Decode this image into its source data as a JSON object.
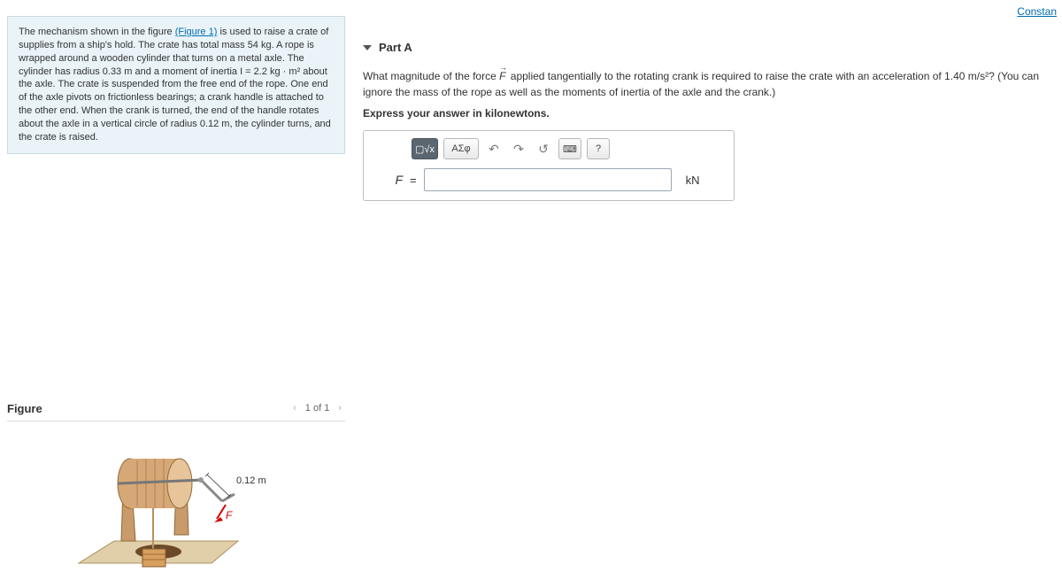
{
  "header": {
    "constants_link": "Constan"
  },
  "problem": {
    "text_before_fig": "The mechanism shown in the figure ",
    "figure_link": "(Figure 1)",
    "text_after_fig": " is used to raise a crate of supplies from a ship's hold. The crate has total mass 54 kg. A rope is wrapped around a wooden cylinder that turns on a metal axle. The cylinder has radius 0.33 m and a moment of inertia I = 2.2 kg · m² about the axle. The crate is suspended from the free end of the rope. One end of the axle pivots on frictionless bearings; a crank handle is attached to the other end. When the crank is turned, the end of the handle rotates about the axle in a vertical circle of radius 0.12 m, the cylinder turns, and the crate is raised."
  },
  "figure": {
    "title": "Figure",
    "nav_label": "1 of 1",
    "crank_radius_label": "0.12 m",
    "force_label": "F"
  },
  "part": {
    "title": "Part A",
    "q_before": "What magnitude of the force ",
    "q_after": " applied tangentially to the rotating crank is required to raise the crate with an acceleration of 1.40 m/s²? (You can ignore the mass of the rope as well as the moments of inertia of the axle and the crank.)",
    "instruction": "Express your answer in kilonewtons.",
    "variable": "F",
    "unit": "kN"
  },
  "toolbar": {
    "templates": "▢√x",
    "symbols": "ΑΣφ",
    "undo": "↶",
    "redo": "↷",
    "reset": "↺",
    "keyboard": "⌨",
    "help": "?"
  }
}
